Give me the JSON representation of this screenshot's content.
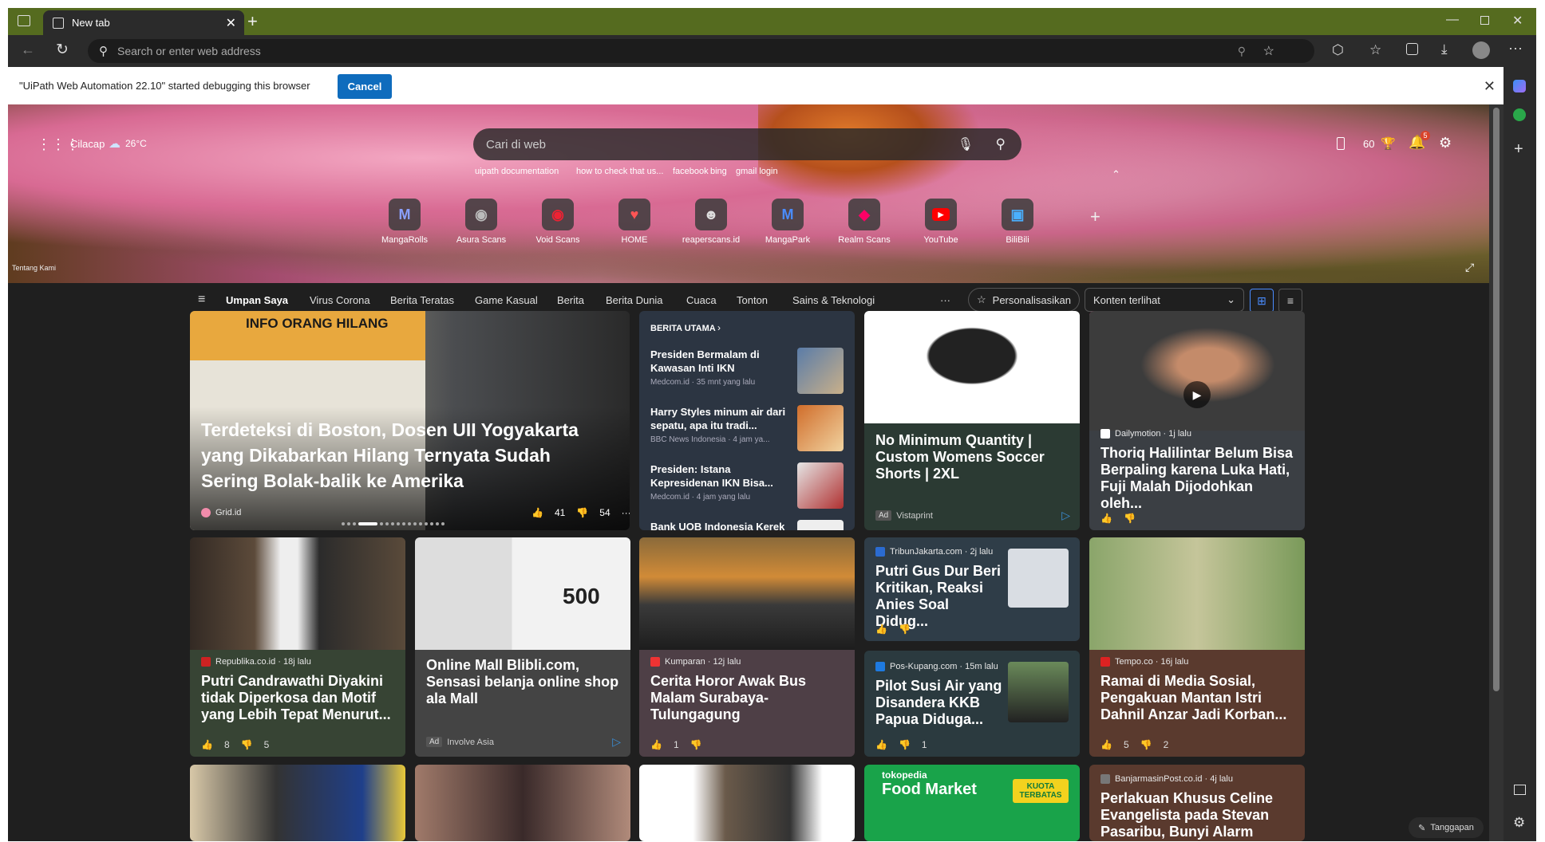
{
  "tab": {
    "title": "New tab"
  },
  "address": {
    "placeholder": "Search or enter web address"
  },
  "debug": {
    "message": "\"UiPath Web Automation 22.10\" started debugging this browser",
    "cancel": "Cancel"
  },
  "weather": {
    "location": "Cilacap",
    "temp": "26°C"
  },
  "search": {
    "placeholder": "Cari di web",
    "suggestions": [
      "uipath documentation",
      "how to check that us...",
      "facebook",
      "bing",
      "gmail login"
    ]
  },
  "rewards": "60",
  "notifications": "5",
  "tiles": [
    "MangaRolls",
    "Asura Scans",
    "Void Scans",
    "HOME",
    "reaperscans.id",
    "MangaPark",
    "Realm Scans",
    "YouTube",
    "BiliBili"
  ],
  "about": "Tentang Kami",
  "nav": {
    "items": [
      "Umpan Saya",
      "Virus Corona",
      "Berita Teratas",
      "Game Kasual",
      "Berita",
      "Berita Dunia",
      "Cuaca",
      "Tonton",
      "Sains & Teknologi"
    ],
    "more": "···",
    "personalize": "Personalisasikan",
    "visible": "Konten terlihat"
  },
  "cards": {
    "hero": {
      "image_text": "INFO ORANG HILANG",
      "title": "Terdeteksi di Boston, Dosen UII Yogyakarta yang Dikabarkan Hilang Ternyata Sudah Sering Bolak-balik ke Amerika",
      "source": "Grid.id",
      "likes": "41",
      "dislikes": "54"
    },
    "top": {
      "header": "BERITA UTAMA",
      "items": [
        {
          "title": "Presiden Bermalam di Kawasan Inti IKN",
          "meta": "Medcom.id · 35 mnt yang lalu"
        },
        {
          "title": "Harry Styles minum air dari sepatu, apa itu tradi...",
          "meta": "BBC News Indonesia · 4 jam ya..."
        },
        {
          "title": "Presiden: Istana Kepresidenan IKN Bisa...",
          "meta": "Medcom.id · 4 jam yang lalu"
        },
        {
          "title": "Bank UOB Indonesia Kerek",
          "meta": ""
        }
      ]
    },
    "ad1": {
      "title": "No Minimum Quantity | Custom Womens Soccer Shorts | 2XL",
      "ad": "Ad",
      "advertiser": "Vistaprint"
    },
    "c4": {
      "source": "Dailymotion · 1j lalu",
      "title": "Thoriq Halilintar Belum Bisa Berpaling karena Luka Hati, Fuji Malah Dijodohkan oleh..."
    },
    "c5": {
      "source": "Republika.co.id · 18j lalu",
      "title": "Putri Candrawathi Diyakini tidak Diperkosa dan Motif yang Lebih Tepat Menurut...",
      "likes": "8",
      "dislikes": "5"
    },
    "c6": {
      "title": "Online Mall Blibli.com, Sensasi belanja online shop ala Mall",
      "ad": "Ad",
      "advertiser": "Involve Asia",
      "promo": "500"
    },
    "c7": {
      "source": "Kumparan · 12j lalu",
      "title": "Cerita Horor Awak Bus Malam Surabaya-Tulungagung",
      "likes": "1"
    },
    "c8": {
      "source": "TribunJakarta.com · 2j lalu",
      "title": "Putri Gus Dur Beri Kritikan, Reaksi Anies Soal Didug..."
    },
    "c9": {
      "source": "Pos-Kupang.com · 15m lalu",
      "title": "Pilot Susi Air yang Disandera KKB Papua Diduga...",
      "dislikes": "1"
    },
    "c10": {
      "source": "Tempo.co · 16j lalu",
      "title": "Ramai di Media Sosial, Pengakuan Mantan Istri Dahnil Anzar Jadi Korban...",
      "likes": "5",
      "dislikes": "2"
    },
    "c11": {
      "banner": "Food Market",
      "badge": "KUOTA TERBATAS",
      "brand": "tokopedia"
    },
    "c12": {
      "source": "BanjarmasinPost.co.id · 4j lalu",
      "title": "Perlakuan Khusus Celine Evangelista pada Stevan Pasaribu, Bunyi Alarm Jadi..."
    }
  },
  "feedback": "Tanggapan"
}
